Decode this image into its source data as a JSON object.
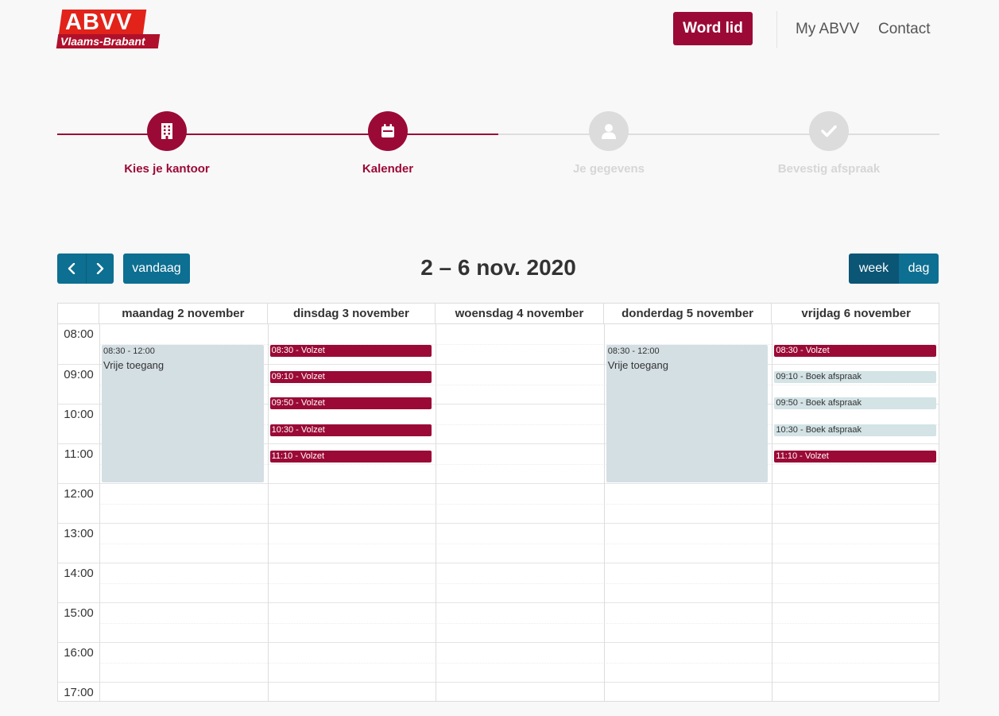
{
  "header": {
    "logo_top": "ABVV",
    "logo_bottom": "Vlaams-Brabant",
    "cta_label": "Word lid",
    "nav": [
      "My ABVV",
      "Contact"
    ]
  },
  "stepper": {
    "steps": [
      {
        "label": "Kies je kantoor",
        "icon": "building-icon",
        "state": "active"
      },
      {
        "label": "Kalender",
        "icon": "calendar-icon",
        "state": "active"
      },
      {
        "label": "Je gegevens",
        "icon": "user-icon",
        "state": "inactive"
      },
      {
        "label": "Bevestig afspraak",
        "icon": "check-icon",
        "state": "inactive"
      }
    ]
  },
  "toolbar": {
    "prev_icon": "chevron-left-icon",
    "next_icon": "chevron-right-icon",
    "today_label": "vandaag",
    "title": "2 – 6 nov. 2020",
    "views": [
      "week",
      "dag"
    ],
    "active_view": "week"
  },
  "calendar": {
    "days": [
      "maandag 2 november",
      "dinsdag 3 november",
      "woensdag 4 november",
      "donderdag 5 november",
      "vrijdag 6 november"
    ],
    "hours": [
      "08:00",
      "09:00",
      "10:00",
      "11:00",
      "12:00",
      "13:00",
      "14:00",
      "15:00",
      "16:00",
      "17:00"
    ],
    "blocks": [
      {
        "day": 0,
        "time": "08:30 - 12:00",
        "title": "Vrije toegang"
      },
      {
        "day": 3,
        "time": "08:30 - 12:00",
        "title": "Vrije toegang"
      }
    ],
    "slots": [
      {
        "day": 1,
        "label": "08:30 - Volzet",
        "status": "full"
      },
      {
        "day": 1,
        "label": "09:10 - Volzet",
        "status": "full"
      },
      {
        "day": 1,
        "label": "09:50 - Volzet",
        "status": "full"
      },
      {
        "day": 1,
        "label": "10:30 - Volzet",
        "status": "full"
      },
      {
        "day": 1,
        "label": "11:10 - Volzet",
        "status": "full"
      },
      {
        "day": 4,
        "label": "08:30 - Volzet",
        "status": "full"
      },
      {
        "day": 4,
        "label": "09:10 - Boek afspraak",
        "status": "open"
      },
      {
        "day": 4,
        "label": "09:50 - Boek afspraak",
        "status": "open"
      },
      {
        "day": 4,
        "label": "10:30 - Boek afspraak",
        "status": "open"
      },
      {
        "day": 4,
        "label": "11:10 - Volzet",
        "status": "full"
      }
    ]
  },
  "colors": {
    "brand": "#9b0a36",
    "logo_red": "#e2231a",
    "toolbar_blue": "#0d6f91",
    "open_slot": "#d3e3e6",
    "block": "#d4dfe4"
  }
}
